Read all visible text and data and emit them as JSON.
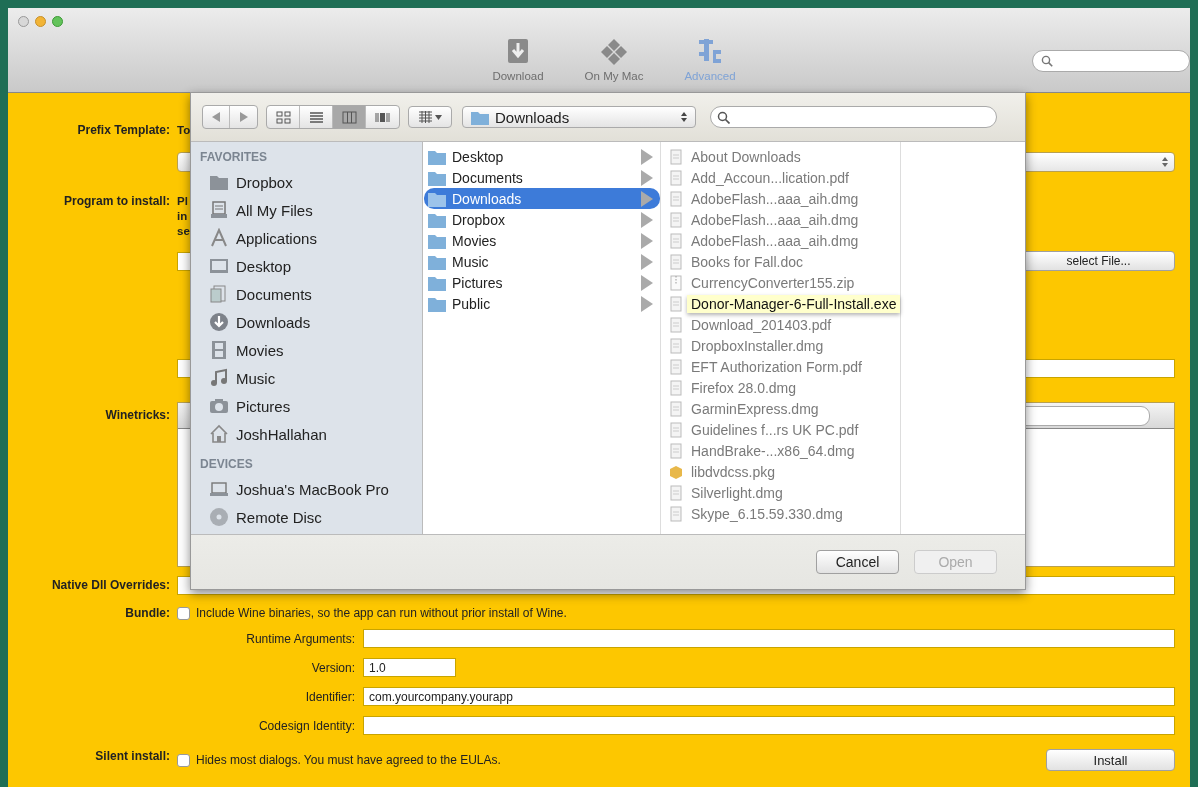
{
  "window": {
    "toolbar": [
      {
        "label": "Download",
        "selected": false
      },
      {
        "label": "On My Mac",
        "selected": false
      },
      {
        "label": "Advanced",
        "selected": true
      }
    ]
  },
  "form": {
    "prefix_template": {
      "label": "Prefix Template:",
      "description": "To"
    },
    "program": {
      "label": "Program to install:",
      "description_lines": [
        "Pl",
        "in",
        "se"
      ],
      "button": "select File..."
    },
    "winetricks": {
      "label": "Winetricks:"
    },
    "dll_overrides": {
      "label": "Native Dll Overrides:"
    },
    "bundle": {
      "label": "Bundle:",
      "checked": false,
      "text": "Include Wine binaries, so the app can run without prior install of Wine."
    },
    "bundle_fields": [
      {
        "label": "Runtime Arguments:",
        "kind": "wide"
      },
      {
        "label": "Version:",
        "value": "1.0",
        "kind": "short"
      },
      {
        "label": "Identifier:",
        "value": "com.yourcompany.yourapp",
        "kind": "wide"
      },
      {
        "label": "Codesign Identity:",
        "kind": "wide"
      }
    ],
    "silent_install": {
      "label": "Silent install:",
      "checked": false,
      "text": "Hides most dialogs. You must have agreed to the EULAs."
    },
    "install_button": "Install"
  },
  "dialog": {
    "view_modes": [
      {
        "selected": false
      },
      {
        "selected": false
      },
      {
        "selected": true
      },
      {
        "selected": false
      }
    ],
    "path": "Downloads",
    "sidebar": [
      {
        "heading": "FAVORITES",
        "items": [
          {
            "label": "Dropbox",
            "kind": "folder"
          },
          {
            "label": "All My Files",
            "kind": "files"
          },
          {
            "label": "Applications",
            "kind": "apps"
          },
          {
            "label": "Desktop",
            "kind": "desktop"
          },
          {
            "label": "Documents",
            "kind": "documents"
          },
          {
            "label": "Downloads",
            "kind": "downloads"
          },
          {
            "label": "Movies",
            "kind": "movies"
          },
          {
            "label": "Music",
            "kind": "music"
          },
          {
            "label": "Pictures",
            "kind": "pictures"
          },
          {
            "label": "JoshHallahan",
            "kind": "home"
          }
        ]
      },
      {
        "heading": "DEVICES",
        "items": [
          {
            "label": "Joshua's MacBook Pro",
            "kind": "laptop"
          },
          {
            "label": "Remote Disc",
            "kind": "disc"
          }
        ]
      }
    ],
    "folders": [
      {
        "label": "Desktop",
        "selected": false
      },
      {
        "label": "Documents",
        "selected": false
      },
      {
        "label": "Downloads",
        "selected": true
      },
      {
        "label": "Dropbox",
        "selected": false
      },
      {
        "label": "Movies",
        "selected": false
      },
      {
        "label": "Music",
        "selected": false
      },
      {
        "label": "Pictures",
        "selected": false
      },
      {
        "label": "Public",
        "selected": false
      }
    ],
    "files": [
      {
        "name": "About Downloads",
        "kind": "document",
        "hovered": false
      },
      {
        "name": "Add_Accoun...lication.pdf",
        "kind": "document",
        "hovered": false
      },
      {
        "name": "AdobeFlash...aaa_aih.dmg",
        "kind": "document",
        "hovered": false
      },
      {
        "name": "AdobeFlash...aaa_aih.dmg",
        "kind": "document",
        "hovered": false
      },
      {
        "name": "AdobeFlash...aaa_aih.dmg",
        "kind": "document",
        "hovered": false
      },
      {
        "name": "Books for Fall.doc",
        "kind": "document",
        "hovered": false
      },
      {
        "name": "CurrencyConverter155.zip",
        "kind": "zip",
        "hovered": false
      },
      {
        "name": "Donor-Manager-6-Full-Install.exe",
        "kind": "document",
        "hovered": true
      },
      {
        "name": "Download_201403.pdf",
        "kind": "document",
        "hovered": false
      },
      {
        "name": "DropboxInstaller.dmg",
        "kind": "document",
        "hovered": false
      },
      {
        "name": "EFT Authorization Form.pdf",
        "kind": "document",
        "hovered": false
      },
      {
        "name": "Firefox 28.0.dmg",
        "kind": "document",
        "hovered": false
      },
      {
        "name": "GarminExpress.dmg",
        "kind": "document",
        "hovered": false
      },
      {
        "name": "Guidelines f...rs UK PC.pdf",
        "kind": "document",
        "hovered": false
      },
      {
        "name": "HandBrake-...x86_64.dmg",
        "kind": "document",
        "hovered": false
      },
      {
        "name": "libdvdcss.pkg",
        "kind": "package",
        "hovered": false
      },
      {
        "name": "Silverlight.dmg",
        "kind": "document",
        "hovered": false
      },
      {
        "name": "Skype_6.15.59.330.dmg",
        "kind": "document",
        "hovered": false
      }
    ],
    "buttons": [
      {
        "label": "Cancel",
        "disabled": false
      },
      {
        "label": "Open",
        "disabled": true
      }
    ]
  }
}
